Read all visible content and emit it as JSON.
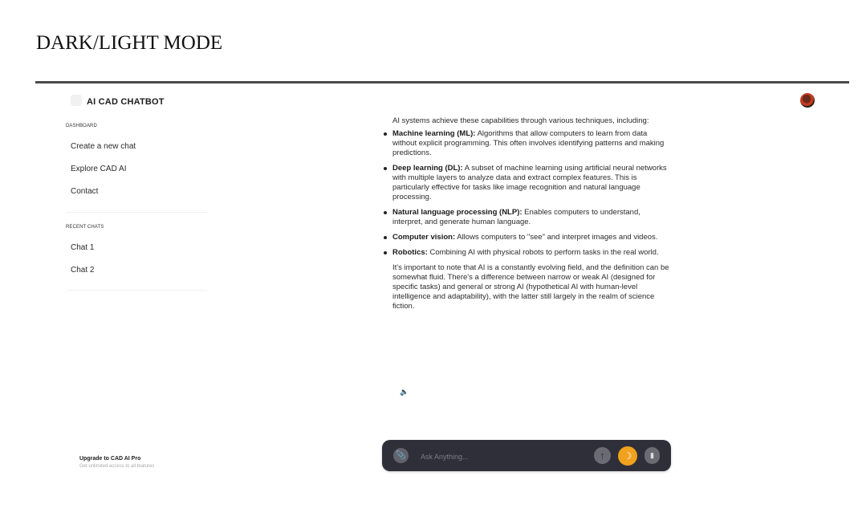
{
  "document": {
    "heading": "DARK/LIGHT MODE"
  },
  "app": {
    "title": "AI CAD CHATBOT"
  },
  "sidebar": {
    "dashboard_label": "DASHBOARD",
    "nav_items": [
      {
        "label": "Create a new chat"
      },
      {
        "label": "Explore CAD AI"
      },
      {
        "label": "Contact"
      }
    ],
    "recent_label": "RECENT CHATS",
    "recent_chats": [
      {
        "label": "Chat 1"
      },
      {
        "label": "Chat 2"
      }
    ],
    "upgrade": {
      "title": "Upgrade to CAD AI Pro",
      "subtitle": "Get unlimited access to all features"
    }
  },
  "chat": {
    "intro": "AI systems achieve these capabilities through various techniques, including:",
    "bullets": [
      {
        "term": "Machine learning (ML):",
        "text": " Algorithms that allow computers to learn from data without explicit programming. This often involves identifying patterns and making predictions."
      },
      {
        "term": "Deep learning (DL):",
        "text": " A subset of machine learning using artificial neural networks with multiple layers to analyze data and extract complex features. This is particularly effective for tasks like image recognition and natural language processing."
      },
      {
        "term": "Natural language processing (NLP):",
        "text": " Enables computers to understand, interpret, and generate human language."
      },
      {
        "term": "Computer vision:",
        "text": " Allows computers to \"see\" and interpret images and videos."
      },
      {
        "term": "Robotics:",
        "text": " Combining AI with physical robots to perform tasks in the real world."
      }
    ],
    "closing": "It's important to note that AI is a constantly evolving field, and the definition can be somewhat fluid. There's a difference between narrow or weak AI (designed for specific tasks) and general or strong AI (hypothetical AI with human-level intelligence and adaptability), with the latter still largely in the realm of science fiction."
  },
  "input_bar": {
    "placeholder": "Ask Anything...",
    "attach_icon": "paperclip-icon",
    "send_icon": "arrow-up-icon",
    "theme_icon": "moon-icon",
    "delete_icon": "trash-icon"
  },
  "colors": {
    "input_bar_bg": "#2f2f3a",
    "theme_button": "#f0a21d",
    "avatar_accent": "#c23a1c"
  }
}
